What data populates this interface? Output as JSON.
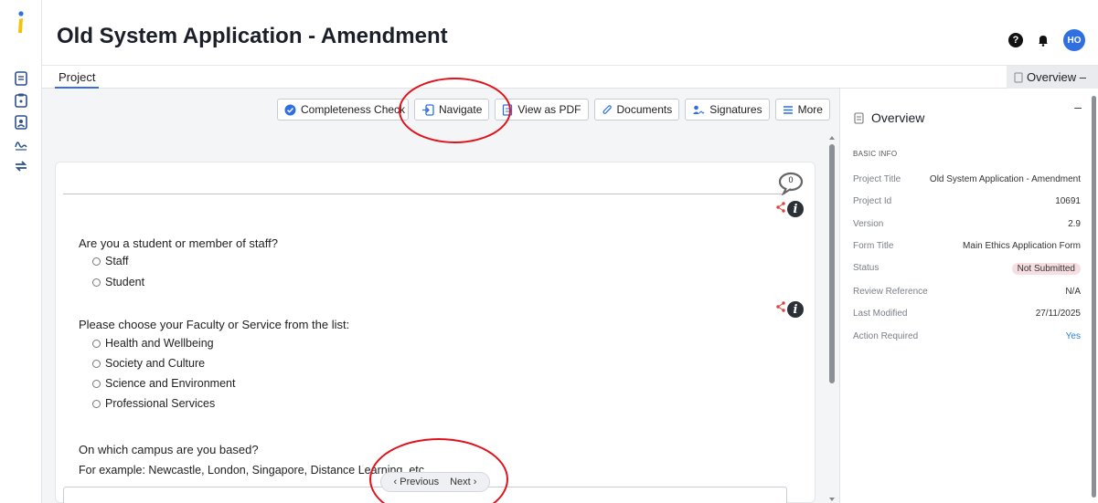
{
  "header": {
    "title": "Old System Application - Amendment",
    "help_label": "?",
    "avatar_initials": "HO"
  },
  "tabs": {
    "project_label": "Project",
    "overview_label": "Overview –"
  },
  "toolbar": {
    "completeness_label": "Completeness Check",
    "navigate_label": "Navigate",
    "pdf_label": "View as PDF",
    "documents_label": "Documents",
    "signatures_label": "Signatures",
    "more_label": "More"
  },
  "form": {
    "comment_count": "0",
    "q1": {
      "text": "Are you a student or member of staff?",
      "options": [
        "Staff",
        "Student"
      ]
    },
    "q2": {
      "text": "Please choose your Faculty or Service from the list:",
      "options": [
        "Health and Wellbeing",
        "Society and Culture",
        "Science and Environment",
        "Professional Services"
      ]
    },
    "q3": {
      "text": "On which campus are you based?",
      "hint": "For example: Newcastle, London, Singapore, Distance Learning, etc."
    }
  },
  "pager": {
    "previous_label": "Previous",
    "next_label": "Next"
  },
  "overview": {
    "title": "Overview",
    "minimize_label": "–",
    "section_label": "BASIC INFO",
    "rows": [
      {
        "key": "Project Title",
        "value": "Old System Application - Amendment"
      },
      {
        "key": "Project Id",
        "value": "10691"
      },
      {
        "key": "Version",
        "value": "2.9"
      },
      {
        "key": "Form Title",
        "value": "Main Ethics Application Form"
      },
      {
        "key": "Status",
        "value": "Not Submitted"
      },
      {
        "key": "Review Reference",
        "value": "N/A"
      },
      {
        "key": "Last Modified",
        "value": "27/11/2025"
      },
      {
        "key": "Action Required",
        "value": "Yes"
      }
    ]
  },
  "colors": {
    "accent": "#2f6fe0",
    "annotation": "#e0121b",
    "share": "#e2403a",
    "badge_bg": "#f6dfe3",
    "link": "#2a7fd4"
  },
  "icons": [
    "logo-icon",
    "document-icon",
    "clipboard-icon",
    "contact-icon",
    "signature-icon",
    "transfer-icon",
    "help-icon",
    "bell-icon",
    "check-circle-icon",
    "navigate-icon",
    "pdf-icon",
    "paperclip-icon",
    "signatures-icon",
    "menu-icon",
    "comment-icon",
    "share-icon",
    "info-icon"
  ]
}
